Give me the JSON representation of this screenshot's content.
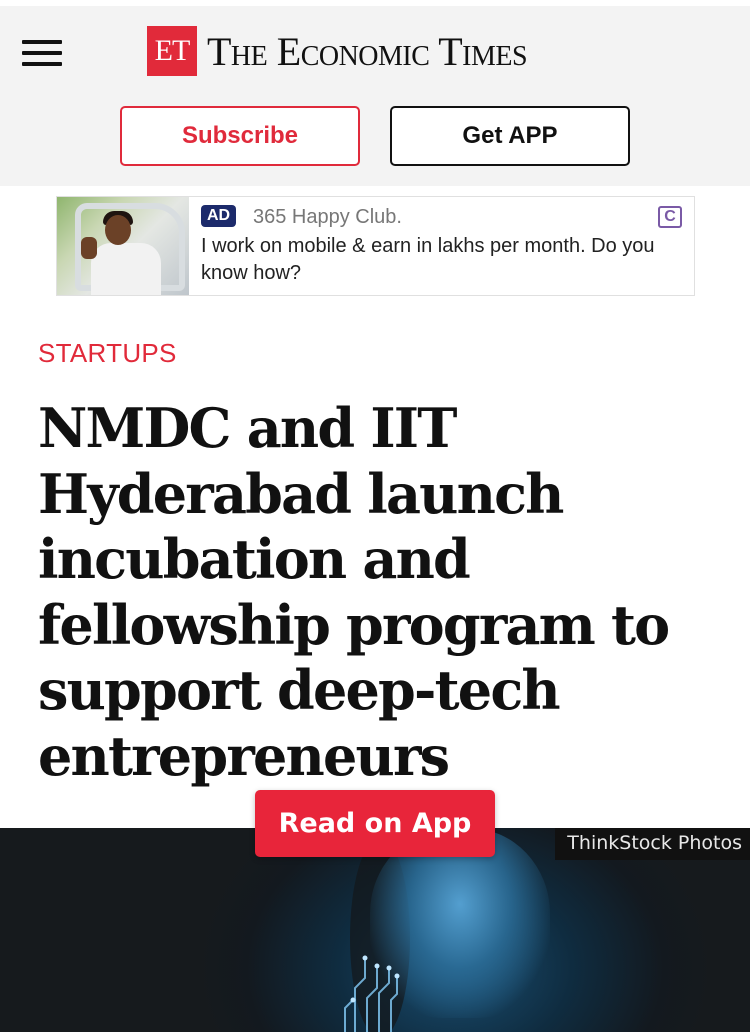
{
  "header": {
    "logo_mark": "ET",
    "logo_text": "The Economic Times",
    "subscribe_label": "Subscribe",
    "get_app_label": "Get APP"
  },
  "ad": {
    "badge": "AD",
    "source": "365 Happy Club.",
    "copy": "I work on mobile & earn in lakhs per month. Do you know how?",
    "choice_icon": "C"
  },
  "article": {
    "category": "STARTUPS",
    "headline": "NMDC and IIT Hyderabad launch incubation and fellowship program to support deep-tech entrepreneurs"
  },
  "hero": {
    "photo_credit": "ThinkStock Photos"
  },
  "cta": {
    "read_on_app": "Read on App"
  },
  "colors": {
    "brand_red": "#e12a3a",
    "cta_red": "#e8253a",
    "ad_badge_navy": "#1c2a6b"
  },
  "icons": [
    "hamburger-menu-icon",
    "ad-choices-icon"
  ]
}
